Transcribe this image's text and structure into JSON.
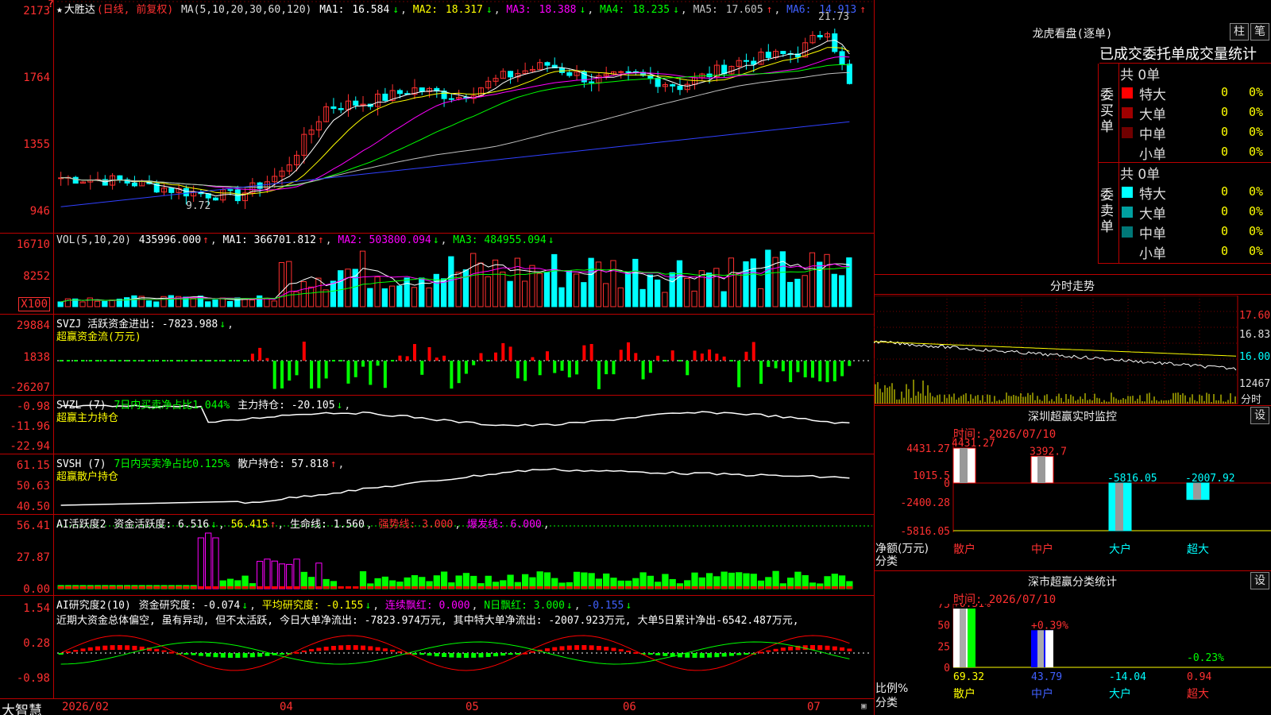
{
  "main": {
    "stock_name": "大胜达",
    "period": "(日线, 前复权)",
    "ma_params": "MA(5,10,20,30,60,120)",
    "ma_values": [
      {
        "label": "MA1:",
        "value": "16.584",
        "color": "#ffffff"
      },
      {
        "label": "MA2:",
        "value": "18.317",
        "color": "#ffff00"
      },
      {
        "label": "MA3:",
        "value": "18.388",
        "color": "#ff00ff"
      },
      {
        "label": "MA4:",
        "value": "18.235",
        "color": "#00ff00"
      },
      {
        "label": "MA5:",
        "value": "17.605",
        "color": "#c0c0c0"
      },
      {
        "label": "MA6:",
        "value": "14.913",
        "color": "#4040ff"
      }
    ],
    "y_labels": [
      "2173",
      "1764",
      "1355",
      "946"
    ],
    "high_mark": "21.73",
    "low_mark": "9.72",
    "marker": "?",
    "price_ylim": [
      9.0,
      22.0
    ]
  },
  "vol": {
    "params": "VOL(5,10,20)",
    "value": "435996.000",
    "ma1": "MA1: 366701.812",
    "ma2": "MA2: 503800.094",
    "ma3": "MA3: 484955.094",
    "y_labels": [
      "16710",
      "8252",
      "X100"
    ]
  },
  "svzj": {
    "title": "SVZJ  活跃资金进出: -7823.988",
    "desc": "超赢资金流(万元)",
    "y_labels": [
      "29884",
      "1838",
      "-26207"
    ]
  },
  "svzl": {
    "title_a": "SVZL (7)",
    "title_b": "7日内买卖净占比1.044%",
    "title_c": "主力持仓: -20.105",
    "desc": "超赢主力持仓",
    "y_labels": [
      "-0.98",
      "-11.96",
      "-22.94"
    ]
  },
  "svsh": {
    "title_a": "SVSH (7)",
    "title_b": "7日内买卖净占比0.125%",
    "title_c": "散户持仓: 57.818",
    "desc": "超赢散户持仓",
    "y_labels": [
      "61.15",
      "50.63",
      "40.50"
    ]
  },
  "ai_active": {
    "title_a": "AI活跃度2",
    "title_b": "资金活跃度: 6.516",
    "title_c": "56.415",
    "title_d": "生命线: 1.560",
    "title_e": "强势线: 3.000",
    "title_f": "爆发线: 6.000",
    "y_labels": [
      "56.41",
      "27.87",
      "0.00"
    ]
  },
  "ai_research": {
    "title_a": "AI研究度2(10)",
    "title_b": "资金研究度: -0.074",
    "title_c": "平均研究度: -0.155",
    "title_d": "连续飘红: 0.000",
    "title_e": "N日飘红: 3.000",
    "title_f": "-0.155",
    "comment": "近期大资金总体偏空, 虽有异动, 但不太活跃, 今日大单净流出: -7823.974万元, 其中特大单净流出: -2007.923万元, 大单5日累计净出-6542.487万元,",
    "y_labels": [
      "1.54",
      "0.28",
      "-0.98"
    ]
  },
  "xaxis": {
    "labels": [
      "2026/02",
      "04",
      "05",
      "06",
      "07"
    ]
  },
  "brand": "大智慧",
  "dragon": {
    "title": "龙虎看盘(逐单)",
    "btn_bar": "柱",
    "btn_pen": "笔",
    "tabs": "已成交委托单成交量统计",
    "buy_label": "委买单",
    "sell_label": "委卖单",
    "buy_total": "共 0单",
    "sell_total": "共 0单",
    "buy_rows": [
      {
        "name": "特大",
        "count": "0",
        "pct": "0%",
        "color": "#ff0000"
      },
      {
        "name": "大单",
        "count": "0",
        "pct": "0%",
        "color": "#a00000"
      },
      {
        "name": "中单",
        "count": "0",
        "pct": "0%",
        "color": "#700000"
      },
      {
        "name": "小单",
        "count": "0",
        "pct": "0%",
        "color": "#000000"
      }
    ],
    "sell_rows": [
      {
        "name": "特大",
        "count": "0",
        "pct": "0%",
        "color": "#00ffff"
      },
      {
        "name": "大单",
        "count": "0",
        "pct": "0%",
        "color": "#00a0a0"
      },
      {
        "name": "中单",
        "count": "0",
        "pct": "0%",
        "color": "#007878"
      },
      {
        "name": "小单",
        "count": "0",
        "pct": "0%",
        "color": "#000000"
      }
    ]
  },
  "intraday": {
    "title": "分时走势",
    "y_labels": [
      "17.60",
      "16.83",
      "16.00",
      "12467"
    ],
    "footer": "分时"
  },
  "monitor": {
    "title": "深圳超赢实时监控",
    "btn": "设",
    "time": "时间: 2026/07/10",
    "y_labels": [
      "4431.27",
      "1015.5",
      "0",
      "-2400.28",
      "-5816.05"
    ],
    "ylabel": "净额(万元)",
    "xlabel": "分类",
    "chart_data": {
      "type": "bar",
      "categories": [
        "散户",
        "中户",
        "大户",
        "超大"
      ],
      "values": [
        4431.27,
        3392.7,
        -5816.05,
        -2007.92
      ],
      "value_labels": [
        "4431.27",
        "3392.7",
        "-5816.05",
        "-2007.92"
      ],
      "ylabel": "净额(万元)",
      "xlabel": "分类",
      "ylim": [
        -5816.05,
        4431.27
      ]
    }
  },
  "classify": {
    "title": "深市超赢分类统计",
    "btn": "设",
    "time": "时间: 2026/07/10",
    "y_labels": [
      "75",
      "50",
      "25",
      "0"
    ],
    "ylabel": "比例%",
    "xlabel": "分类",
    "chart_data": {
      "type": "bar",
      "categories": [
        "散户",
        "中户",
        "大户",
        "超大"
      ],
      "values": [
        0.51,
        0.39,
        0,
        -0.23
      ],
      "value_labels": [
        "+0.51%",
        "+0.39%",
        "",
        "-0.23%"
      ],
      "bottom_values": [
        "69.32",
        "43.79",
        "-14.04",
        "0.94"
      ],
      "ylabel": "比例%",
      "ylim": [
        0,
        75
      ]
    }
  }
}
